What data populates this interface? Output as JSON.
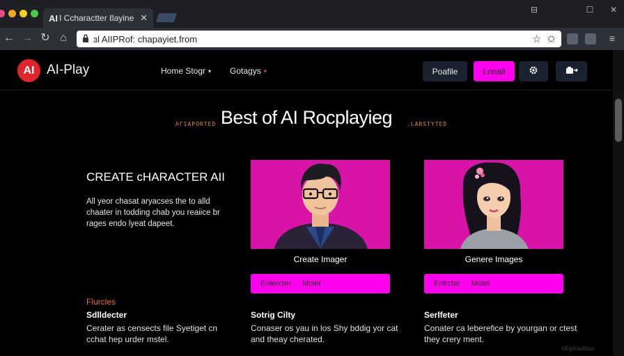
{
  "browser": {
    "tab_title": "Ι Ccharactter ℓlaуine",
    "tab_logo": "AI",
    "tab_close": "✕",
    "url": "ɜl AΙΙPRof: chapayiet.from",
    "controls": {
      "minimize": "⊟",
      "maximize": "☐",
      "close": "✕"
    },
    "nav": {
      "back": "←",
      "forward": "→",
      "reload": "↻",
      "home": "⌂"
    }
  },
  "header": {
    "logo_badge": "AI",
    "logo_text": "AI-Play",
    "nav": [
      {
        "label": "Home Stogr",
        "caret": "▾"
      },
      {
        "label": "Gotagys",
        "caret": "▾"
      }
    ],
    "buttons": {
      "profile": "Poafile",
      "login": "Lonall"
    }
  },
  "hero": {
    "title": "Best of AI Rocplayieg",
    "tag_left": "ΛΓIAPORTED",
    "tag_right": ".LARSTYTED"
  },
  "intro": {
    "heading": "CREATE cHARACTER AII",
    "body": "All yeor chasat aryacses the to alld chaater in todding chab you reaiice br rages endo lyeat dapeet."
  },
  "cards": [
    {
      "caption": "Create Imager",
      "bar_left": "Enlercter",
      "bar_right": "Molel"
    },
    {
      "caption": "Genere Images",
      "bar_left": "Enlrcter",
      "bar_right": "Molel"
    }
  ],
  "features": {
    "tag": "Flurcles",
    "items": [
      {
        "title": "Sdlldecter",
        "body": "Cerater as censects file Syetiget cn cchat hep urder mstel."
      },
      {
        "title": "Sotrig Cilty",
        "body": "Conaser os yau in los Shy bddig yor cat and theay cherated."
      },
      {
        "title": "Serlfeter",
        "body": "Conater ca leberefice by yourgan or ctest they crery ment."
      }
    ]
  },
  "watermark": "©Fgtr/astlzus",
  "colors": {
    "accent": "#ff00ee",
    "card_bg": "#d913a8",
    "logo_red": "#e0242b",
    "tag_orange": "#e88a3c"
  }
}
